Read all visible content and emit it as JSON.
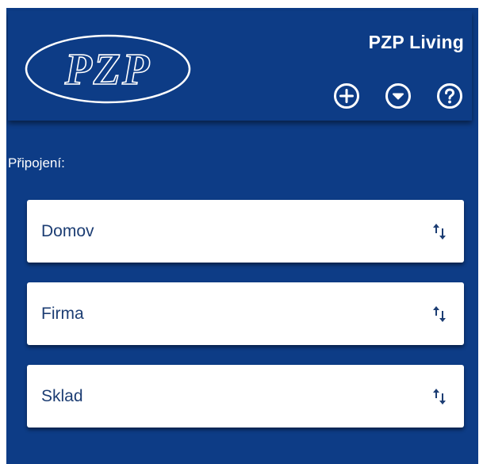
{
  "header": {
    "logo_text": "PZP",
    "app_title": "PZP Living",
    "icons": [
      "plus-circle-icon",
      "chevron-down-circle-icon",
      "question-circle-icon"
    ]
  },
  "connections": {
    "label": "Připojení:",
    "items": [
      {
        "name": "Domov",
        "icon": "swap-arrows-icon"
      },
      {
        "name": "Firma",
        "icon": "swap-arrows-icon"
      },
      {
        "name": "Sklad",
        "icon": "swap-arrows-icon"
      }
    ]
  },
  "colors": {
    "background": "#0d3c86",
    "card": "#ffffff",
    "card_text": "#1c3d73",
    "header_text": "#ffffff"
  }
}
